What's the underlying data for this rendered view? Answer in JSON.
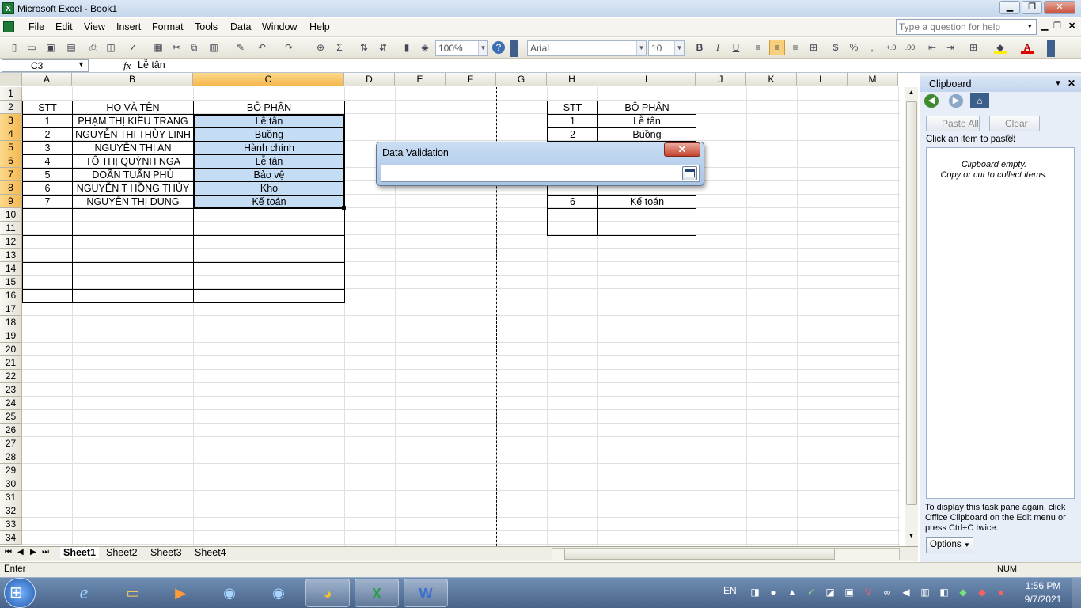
{
  "window": {
    "title": "Microsoft Excel - Book1",
    "min": "▁",
    "restore": "❐",
    "close": "✕"
  },
  "menu": [
    "File",
    "Edit",
    "View",
    "Insert",
    "Format",
    "Tools",
    "Data",
    "Window",
    "Help"
  ],
  "help_placeholder": "Type a question for help",
  "toolbar": {
    "zoom": "100%",
    "font": "Arial",
    "size": "10",
    "bold": "B",
    "italic": "I",
    "underline": "U",
    "currency": "$",
    "percent": "%",
    "comma": ","
  },
  "formula": {
    "name_box": "C3",
    "fx": "fx",
    "value": "Lễ tân"
  },
  "columns": [
    "A",
    "B",
    "C",
    "D",
    "E",
    "F",
    "G",
    "H",
    "I",
    "J",
    "K",
    "L",
    "M"
  ],
  "rows": [
    "1",
    "2",
    "3",
    "4",
    "5",
    "6",
    "7",
    "8",
    "9",
    "10",
    "11",
    "12",
    "13",
    "14",
    "15",
    "16",
    "17",
    "18",
    "19",
    "20",
    "21",
    "22",
    "23",
    "24",
    "25",
    "26",
    "27",
    "28",
    "29",
    "30",
    "31",
    "32",
    "33",
    "34"
  ],
  "table1": {
    "header": [
      "STT",
      "HỌ VÀ TÊN",
      "BỘ PHẬN"
    ],
    "rows": [
      [
        "1",
        "PHẠM THỊ KIỀU TRANG",
        "Lễ tân"
      ],
      [
        "2",
        "NGUYỄN THỊ THÙY LINH",
        "Buồng"
      ],
      [
        "3",
        "NGUYỄN THỊ AN",
        "Hành chính"
      ],
      [
        "4",
        "TÔ THỊ QUỲNH NGA",
        "Lễ tân"
      ],
      [
        "5",
        "DOÃN TUẤN PHÚ",
        "Bảo vệ"
      ],
      [
        "6",
        "NGUYỄN T HỒNG THỦY",
        "Kho"
      ],
      [
        "7",
        "NGUYỄN THỊ DUNG",
        "Kế toán"
      ]
    ]
  },
  "table2": {
    "header": [
      "STT",
      "BỘ PHẬN"
    ],
    "rows": [
      [
        "1",
        "Lễ tân"
      ],
      [
        "2",
        "Buồng"
      ],
      [
        "6",
        "Kế toán"
      ]
    ]
  },
  "sheets": [
    "Sheet1",
    "Sheet2",
    "Sheet3",
    "Sheet4"
  ],
  "status": {
    "mode": "Enter",
    "num": "NUM"
  },
  "pane": {
    "title": "Clipboard",
    "paste_all": "Paste All",
    "clear_all": "Clear All",
    "click_text": "Click an item to paste:",
    "empty1": "Clipboard empty.",
    "empty2": "Copy or cut to collect items.",
    "footer": "To display this task pane again, click Office Clipboard on the Edit menu or press Ctrl+C twice.",
    "options": "Options"
  },
  "dialog": {
    "title": "Data Validation",
    "close": "✕"
  },
  "taskbar": {
    "lang": "EN",
    "time": "1:56 PM",
    "date": "9/7/2021"
  }
}
